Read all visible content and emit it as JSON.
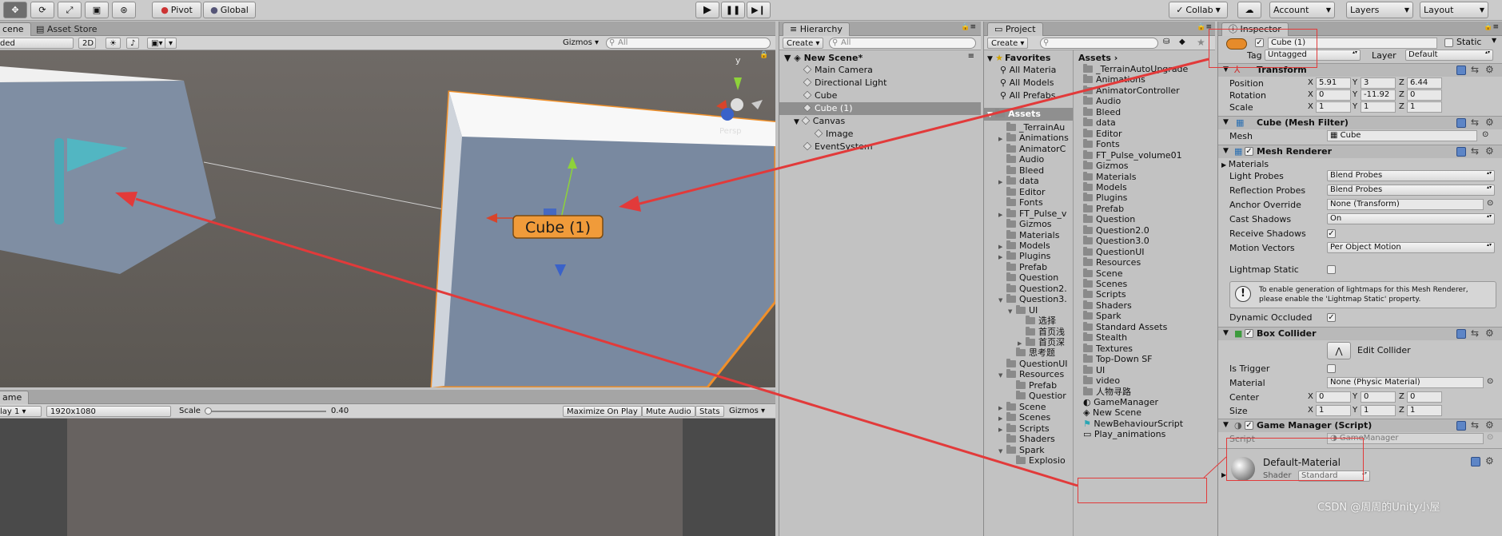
{
  "toolbar": {
    "pivot": "Pivot",
    "global": "Global",
    "collab": "Collab",
    "account": "Account",
    "layers": "Layers",
    "layout": "Layout"
  },
  "scene": {
    "tab_scene": "cene",
    "tab_store": "Asset Store",
    "shaded": "ded",
    "twod": "2D",
    "gizmos": "Gizmos",
    "search": "All",
    "label": "Cube (1)",
    "persp": "Persp",
    "gizmo_y": "y"
  },
  "game": {
    "tab": "ame",
    "display": "lay 1",
    "resolution": "1920x1080",
    "scale_label": "Scale",
    "scale_value": "0.40",
    "maximize": "Maximize On Play",
    "mute": "Mute Audio",
    "stats": "Stats",
    "gizmos": "Gizmos"
  },
  "hierarchy": {
    "tab": "Hierarchy",
    "create": "Create",
    "search": "All",
    "scene_name": "New Scene*",
    "items": [
      "Main Camera",
      "Directional Light",
      "Cube",
      "Cube (1)",
      "Canvas",
      "Image",
      "EventSystem"
    ]
  },
  "project": {
    "tab": "Project",
    "create": "Create",
    "favorites": "Favorites",
    "fav_items": [
      "All Materia",
      "All Models",
      "All Prefabs"
    ],
    "assets_root": "Assets",
    "tree": [
      "_TerrainAu",
      "Animations",
      "AnimatorC",
      "Audio",
      "Bleed",
      "data",
      "Editor",
      "Fonts",
      "FT_Pulse_v",
      "Gizmos",
      "Materials",
      "Models",
      "Plugins",
      "Prefab",
      "Question",
      "Question2.",
      "Question3.",
      "UI",
      "选择",
      "首页浅",
      "首页深",
      "思考题",
      "QuestionUI",
      "Resources",
      "Prefab",
      "Questior",
      "Scene",
      "Scenes",
      "Scripts",
      "Shaders",
      "Spark",
      "Explosio"
    ],
    "breadcrumb": "Assets",
    "assets": [
      "_TerrainAutoUpgrade",
      "Animations",
      "AnimatorController",
      "Audio",
      "Bleed",
      "data",
      "Editor",
      "Fonts",
      "FT_Pulse_volume01",
      "Gizmos",
      "Materials",
      "Models",
      "Plugins",
      "Prefab",
      "Question",
      "Question2.0",
      "Question3.0",
      "QuestionUI",
      "Resources",
      "Scene",
      "Scenes",
      "Scripts",
      "Shaders",
      "Spark",
      "Standard Assets",
      "Stealth",
      "Textures",
      "Top-Down SF",
      "UI",
      "video",
      "人物寻路",
      "GameManager",
      "New Scene",
      "NewBehaviourScript",
      "Play_animations"
    ]
  },
  "inspector": {
    "tab": "Inspector",
    "name": "Cube (1)",
    "static": "Static",
    "tag_label": "Tag",
    "tag": "Untagged",
    "layer_label": "Layer",
    "layer": "Default",
    "transform": {
      "title": "Transform",
      "position_label": "Position",
      "rotation_label": "Rotation",
      "scale_label": "Scale",
      "position": [
        "5.91",
        "3",
        "6.44"
      ],
      "rotation": [
        "0",
        "-11.92",
        "0"
      ],
      "scale": [
        "1",
        "1",
        "1"
      ]
    },
    "mesh_filter": {
      "title": "Cube (Mesh Filter)",
      "mesh_label": "Mesh",
      "mesh": "Cube"
    },
    "mesh_renderer": {
      "title": "Mesh Renderer",
      "materials": "Materials",
      "light_probes_label": "Light Probes",
      "light_probes": "Blend Probes",
      "reflection_probes_label": "Reflection Probes",
      "reflection_probes": "Blend Probes",
      "anchor_label": "Anchor Override",
      "anchor": "None (Transform)",
      "cast_label": "Cast Shadows",
      "cast": "On",
      "receive_label": "Receive Shadows",
      "motion_label": "Motion Vectors",
      "motion": "Per Object Motion",
      "lightmap_label": "Lightmap Static",
      "help_line1": "To enable generation of lightmaps for this Mesh Renderer,",
      "help_line2": "please enable the 'Lightmap Static' property.",
      "dynamic_label": "Dynamic Occluded"
    },
    "box_collider": {
      "title": "Box Collider",
      "edit": "Edit Collider",
      "trigger_label": "Is Trigger",
      "material_label": "Material",
      "material": "None (Physic Material)",
      "center_label": "Center",
      "size_label": "Size",
      "center": [
        "0",
        "0",
        "0"
      ],
      "size": [
        "1",
        "1",
        "1"
      ]
    },
    "game_manager": {
      "title": "Game Manager (Script)",
      "script_label": "Script",
      "script": "GameManager"
    },
    "material": {
      "title": "Default-Material",
      "shader_label": "Shader",
      "shader": "Standard"
    },
    "axis": [
      "X",
      "Y",
      "Z"
    ]
  },
  "watermark": "CSDN @周周的Unity小屋"
}
